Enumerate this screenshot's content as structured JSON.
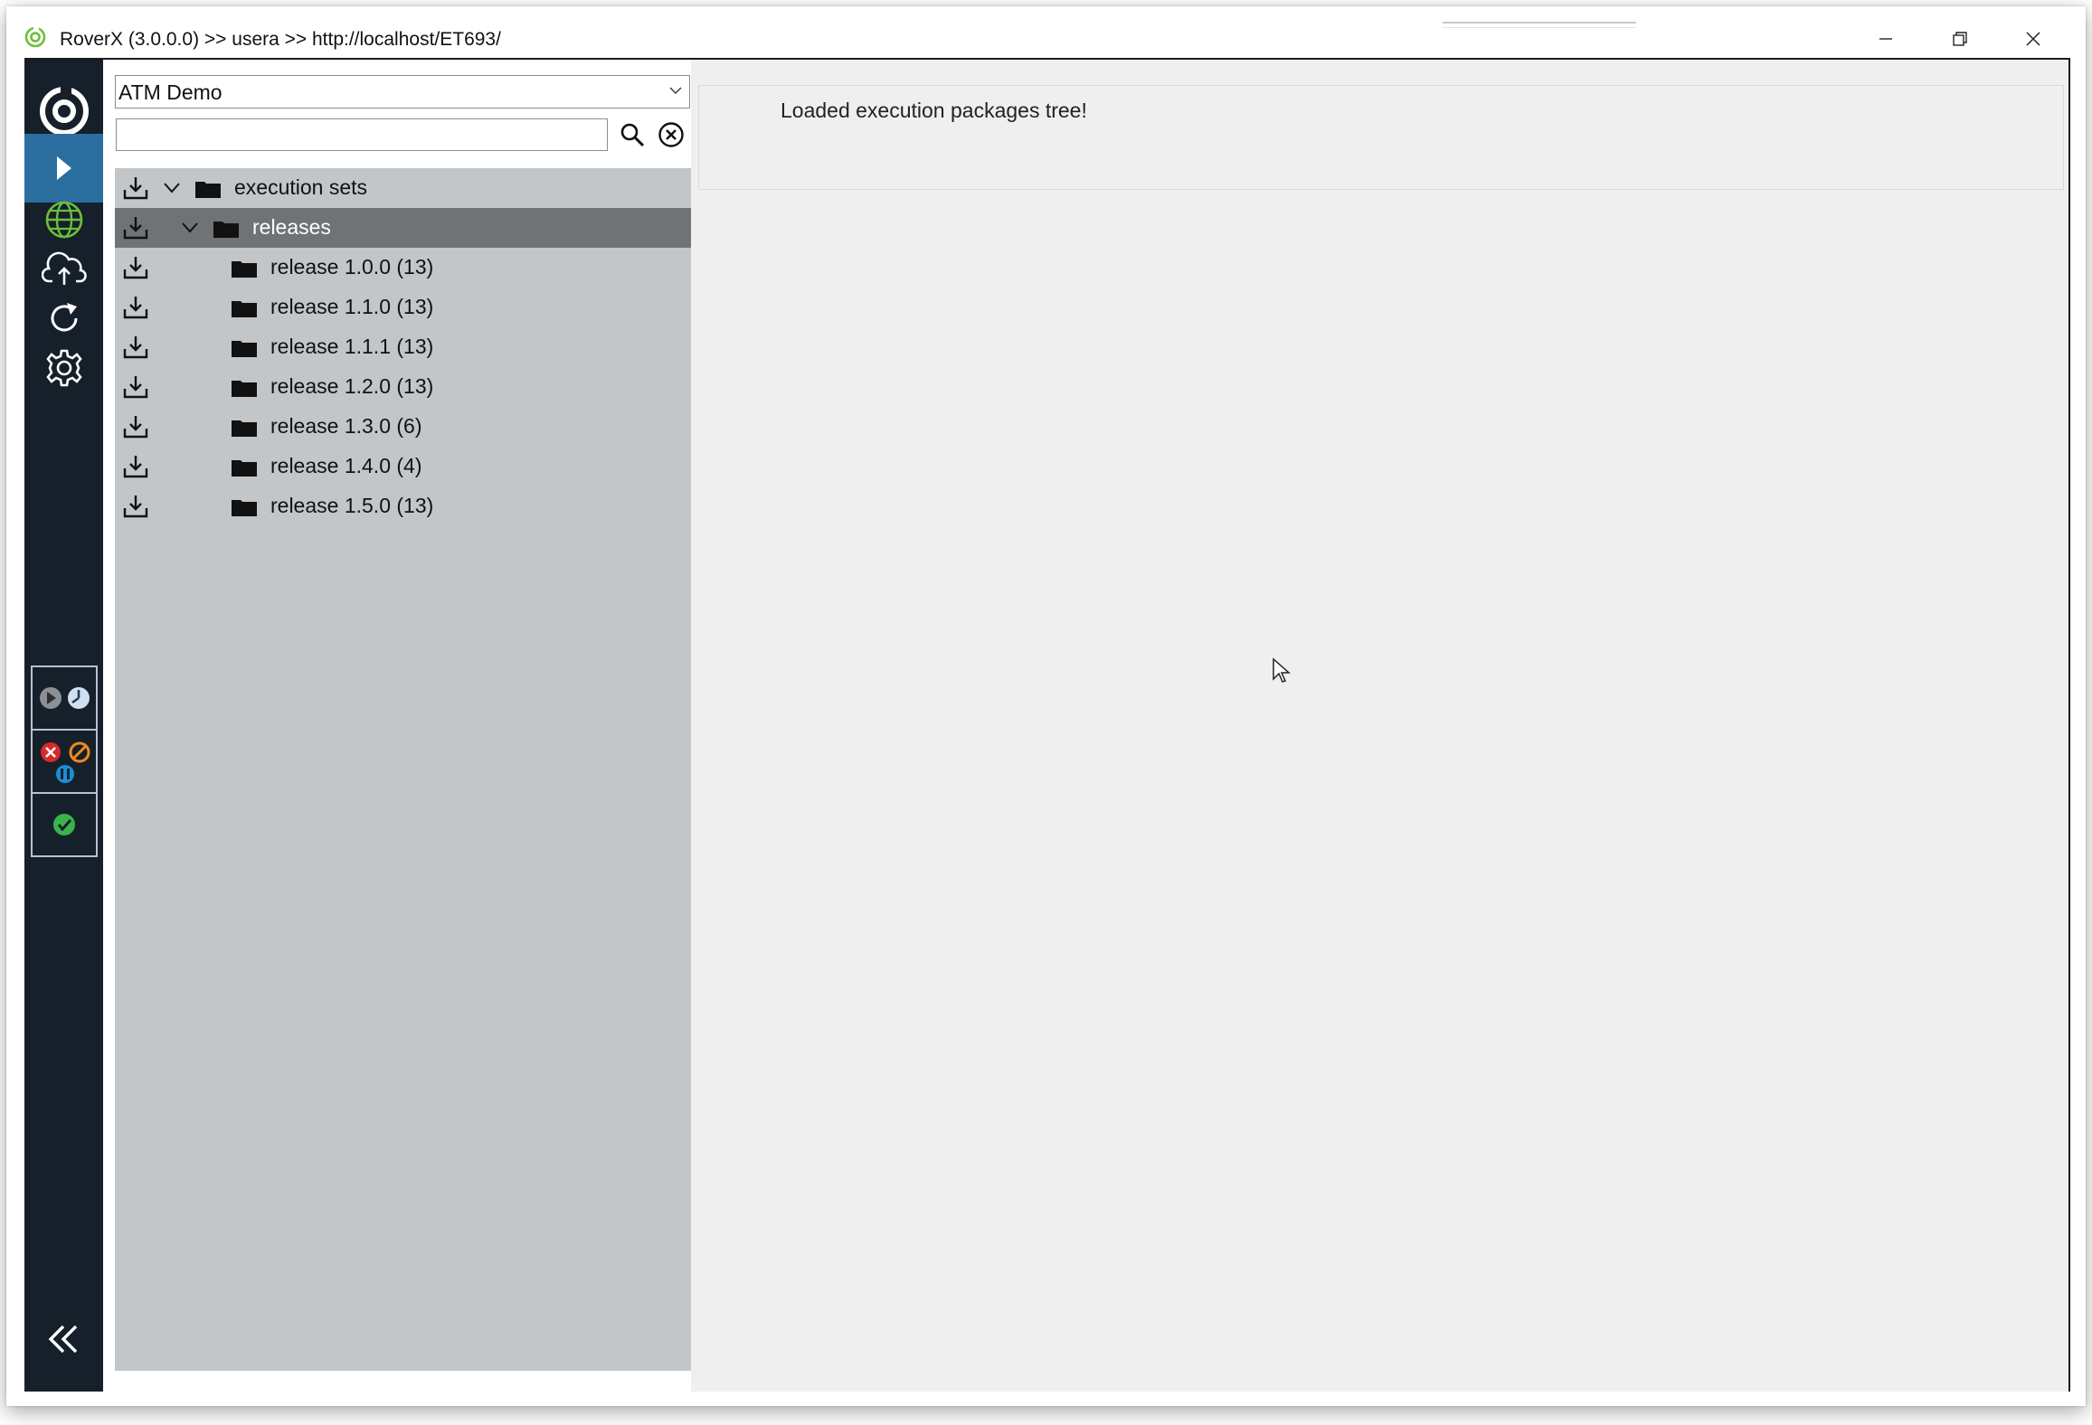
{
  "window": {
    "title": "RoverX (3.0.0.0) >> usera >> http://localhost/ET693/"
  },
  "sidebar": {
    "items": [
      {
        "name": "execution",
        "icon": "play-icon",
        "active": true
      },
      {
        "name": "web",
        "icon": "globe-icon",
        "active": false
      },
      {
        "name": "upload",
        "icon": "cloud-upload-icon",
        "active": false
      },
      {
        "name": "refresh",
        "icon": "refresh-icon",
        "active": false
      },
      {
        "name": "settings",
        "icon": "gear-icon",
        "active": false
      }
    ],
    "status_groups": [
      "pending-running",
      "failed-blocked-paused",
      "passed"
    ],
    "collapse_icon": "double-chevron-left-icon"
  },
  "left_panel": {
    "project": "ATM Demo",
    "search_value": "",
    "tree": [
      {
        "label": "execution sets",
        "level": 0,
        "expanded": true,
        "selected": false
      },
      {
        "label": "releases",
        "level": 1,
        "expanded": true,
        "selected": true
      },
      {
        "label": "release 1.0.0 (13)",
        "level": 2,
        "selected": false
      },
      {
        "label": "release 1.1.0 (13)",
        "level": 2,
        "selected": false
      },
      {
        "label": "release 1.1.1 (13)",
        "level": 2,
        "selected": false
      },
      {
        "label": "release 1.2.0 (13)",
        "level": 2,
        "selected": false
      },
      {
        "label": "release 1.3.0 (6)",
        "level": 2,
        "selected": false
      },
      {
        "label": "release 1.4.0 (4)",
        "level": 2,
        "selected": false
      },
      {
        "label": "release 1.5.0 (13)",
        "level": 2,
        "selected": false
      }
    ]
  },
  "main": {
    "message": "Loaded execution packages tree!"
  },
  "colors": {
    "sidebar_bg": "#15202b",
    "sidebar_active": "#2b6fa0",
    "tree_bg": "#c2c6c8",
    "tree_selected": "#6f7375",
    "main_bg": "#efefef",
    "logo_green": "#6bbf3b"
  }
}
